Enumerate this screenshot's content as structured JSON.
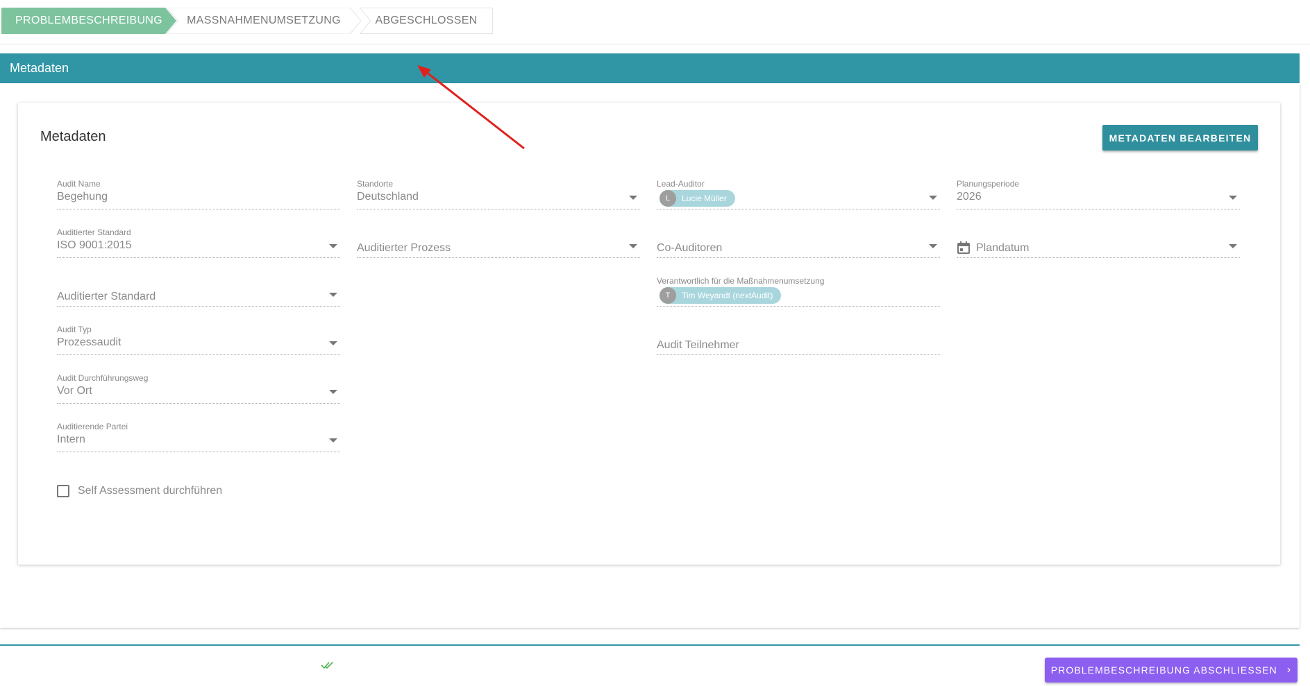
{
  "stepper": {
    "steps": [
      {
        "label": "PROBLEMBESCHREIBUNG",
        "active": true
      },
      {
        "label": "MASSNAHMENUMSETZUNG",
        "active": false
      },
      {
        "label": "ABGESCHLOSSEN",
        "active": false
      }
    ]
  },
  "section": {
    "title": "Metadaten"
  },
  "card": {
    "title": "Metadaten",
    "edit_button": "METADATEN BEARBEITEN"
  },
  "fields": {
    "audit_name": {
      "label": "Audit Name",
      "value": "Begehung"
    },
    "standorte": {
      "label": "Standorte",
      "value": "Deutschland"
    },
    "lead_auditor": {
      "label": "Lead-Auditor",
      "chip_initial": "L",
      "chip_name": "Lucie Müller"
    },
    "planungsperiode": {
      "label": "Planungsperiode",
      "value": "2026"
    },
    "auditierter_standard": {
      "label": "Auditierter Standard",
      "value": "ISO 9001:2015"
    },
    "auditierter_prozess": {
      "placeholder": "Auditierter Prozess"
    },
    "co_auditoren": {
      "placeholder": "Co-Auditoren"
    },
    "plandatum": {
      "placeholder": "Plandatum"
    },
    "auditierter_standard_2": {
      "placeholder": "Auditierter Standard"
    },
    "verantwortlich": {
      "label": "Verantwortlich für die Maßnahmenumsetzung",
      "chip_initial": "T",
      "chip_name": "Tim Weyandt (nextAudit)"
    },
    "audit_typ": {
      "label": "Audit Typ",
      "value": "Prozessaudit"
    },
    "audit_teilnehmer": {
      "placeholder": "Audit Teilnehmer"
    },
    "durchfuehrungsweg": {
      "label": "Audit Durchführungsweg",
      "value": "Vor Ort"
    },
    "auditierende_partei": {
      "label": "Auditierende Partei",
      "value": "Intern"
    }
  },
  "self_assessment": {
    "label": "Self Assessment durchführen",
    "checked": false
  },
  "footer": {
    "finish_button": "PROBLEMBESCHREIBUNG ABSCHLIESSEN"
  },
  "colors": {
    "teal": "#3096a6",
    "active_step": "#7cc39e",
    "purple": "#8c5ff0",
    "arrow": "#e0201c"
  }
}
